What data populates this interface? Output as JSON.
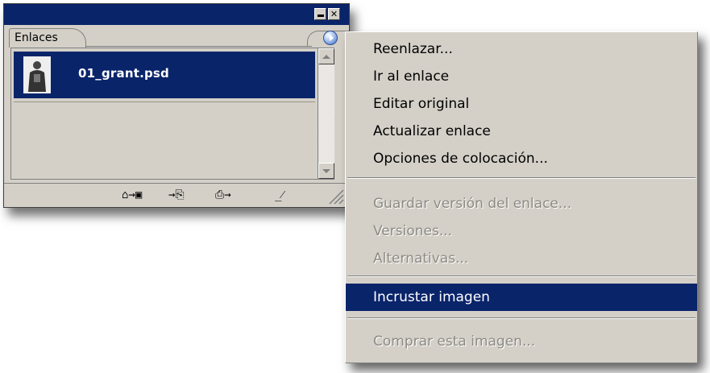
{
  "panel": {
    "tab_label": "Enlaces",
    "minimize_glyph": "−",
    "close_glyph": "✕",
    "links": [
      {
        "name": "01_grant.psd",
        "selected": true
      }
    ],
    "bottom_tools": [
      {
        "icon": "relink-icon",
        "glyph": "⌂→▣"
      },
      {
        "icon": "go-to-link-icon",
        "glyph": "→⎘"
      },
      {
        "icon": "update-link-icon",
        "glyph": "⎙→"
      },
      {
        "icon": "edit-original-icon",
        "glyph": "_⁄"
      }
    ]
  },
  "context_menu": {
    "items": [
      {
        "label": "Reenlazar...",
        "enabled": true
      },
      {
        "label": "Ir al enlace",
        "enabled": true
      },
      {
        "label": "Editar original",
        "enabled": true
      },
      {
        "label": "Actualizar enlace",
        "enabled": true
      },
      {
        "label": "Opciones de colocación...",
        "enabled": true
      },
      {
        "label": "Guardar versión del enlace...",
        "enabled": false
      },
      {
        "label": "Versiones...",
        "enabled": false
      },
      {
        "label": "Alternativas...",
        "enabled": false
      },
      {
        "label": "Incrustar imagen",
        "enabled": true,
        "highlighted": true
      },
      {
        "label": "Comprar esta imagen...",
        "enabled": false
      }
    ]
  },
  "colors": {
    "title_bar": "#0a246a",
    "selection": "#0a246a",
    "face": "#d4d0c8",
    "disabled_text": "#8e8a84"
  }
}
